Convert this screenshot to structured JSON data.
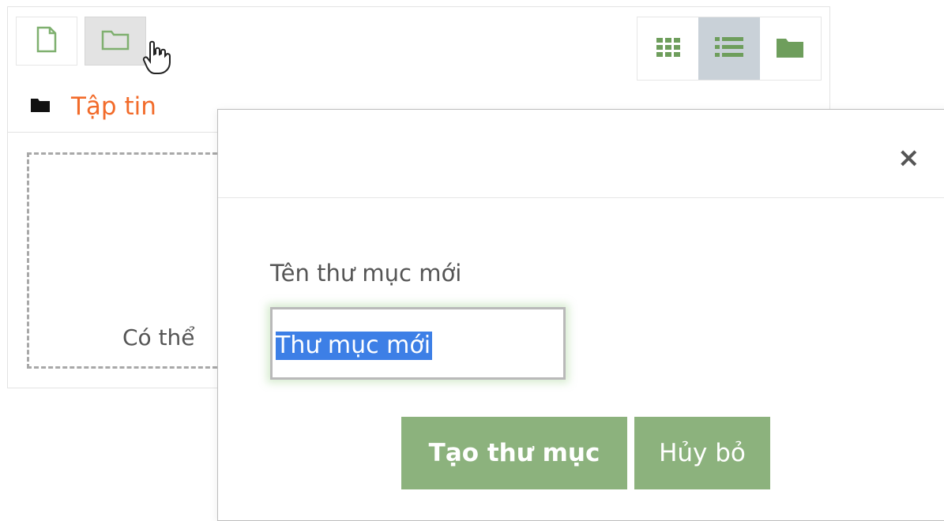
{
  "toolbar": {
    "new_file_icon": "file-icon",
    "new_folder_icon": "folder-icon",
    "views": [
      {
        "icon": "grid-view-icon",
        "active": false
      },
      {
        "icon": "list-view-icon",
        "active": true
      },
      {
        "icon": "tree-view-folder-icon",
        "active": false
      }
    ]
  },
  "path": {
    "icon": "folder-icon",
    "label": "Tập tin"
  },
  "dropzone": {
    "text": "Có thể"
  },
  "dialog": {
    "close_symbol": "×",
    "field_label": "Tên thư mục mới",
    "input_value": "Thư mục mới",
    "primary_button": "Tạo thư mục",
    "secondary_button": "Hủy bỏ"
  },
  "colors": {
    "accent_green": "#8cb27d",
    "path_orange": "#f26b2a",
    "active_view": "#c9d1d8",
    "selection_blue": "#3d7fe6"
  }
}
